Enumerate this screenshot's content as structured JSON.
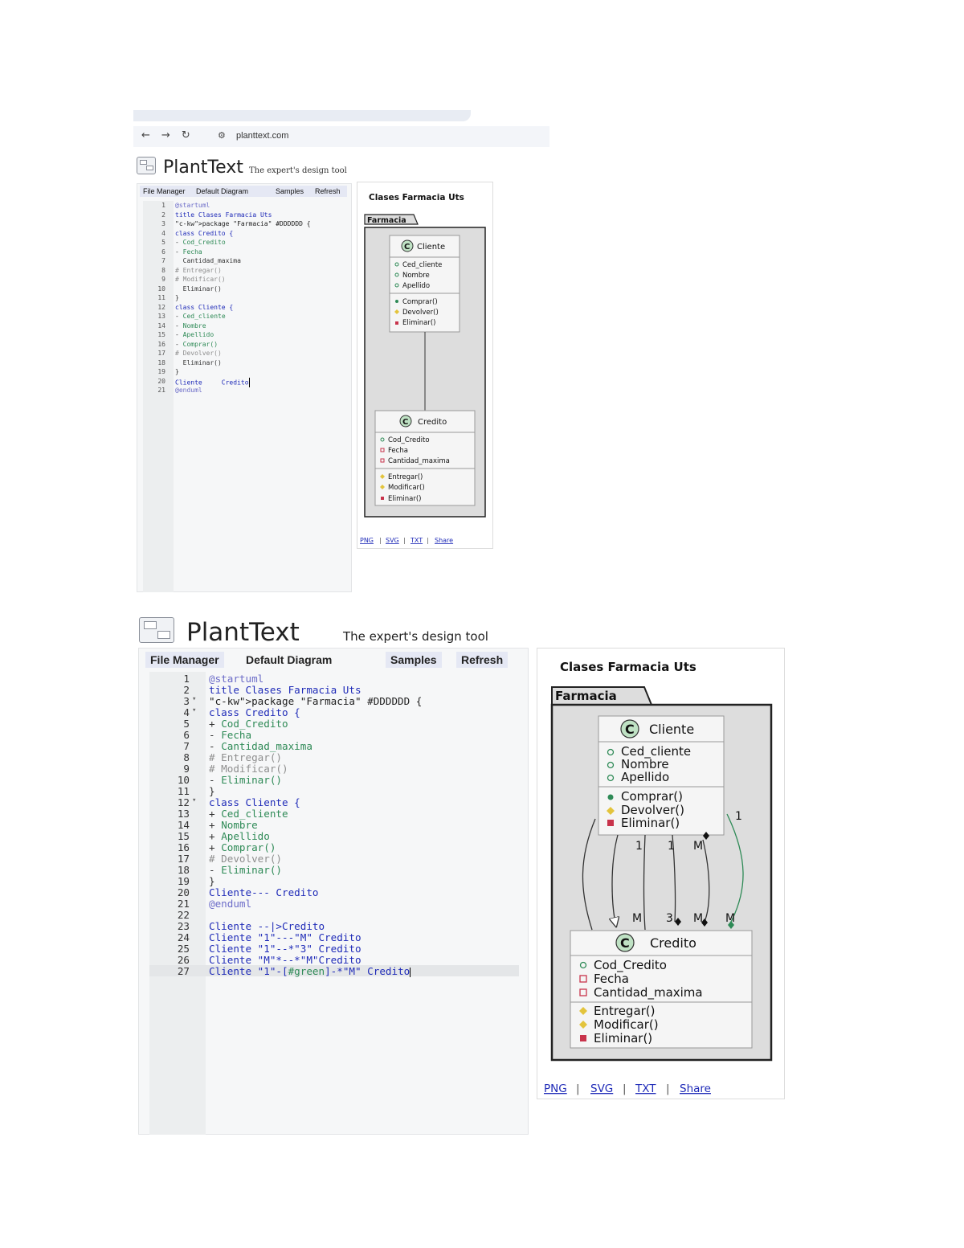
{
  "browser": {
    "url": "planttext.com"
  },
  "app": {
    "name": "PlantText",
    "tagline": "The expert's design tool"
  },
  "toolbar": {
    "file_manager": "File Manager",
    "default_diagram": "Default Diagram",
    "samples": "Samples",
    "refresh": "Refresh"
  },
  "editor_top": {
    "lines": [
      {
        "n": "1",
        "t": "@startuml"
      },
      {
        "n": "2",
        "t": "title Clases Farmacia Uts"
      },
      {
        "n": "3",
        "t": "package \"Farmacia\" #DDDDDD {"
      },
      {
        "n": "4",
        "t": "class Credito {"
      },
      {
        "n": "5",
        "t": "- Cod_Credito"
      },
      {
        "n": "6",
        "t": "- Fecha"
      },
      {
        "n": "7",
        "t": "  Cantidad_maxima"
      },
      {
        "n": "8",
        "t": "# Entregar()"
      },
      {
        "n": "9",
        "t": "# Modificar()"
      },
      {
        "n": "10",
        "t": "  Eliminar()"
      },
      {
        "n": "11",
        "t": "}"
      },
      {
        "n": "12",
        "t": "class Cliente {"
      },
      {
        "n": "13",
        "t": "- Ced_cliente"
      },
      {
        "n": "14",
        "t": "- Nombre"
      },
      {
        "n": "15",
        "t": "- Apellido"
      },
      {
        "n": "16",
        "t": "- Comprar()"
      },
      {
        "n": "17",
        "t": "# Devolver()"
      },
      {
        "n": "18",
        "t": "  Eliminar()"
      },
      {
        "n": "19",
        "t": "}"
      },
      {
        "n": "20",
        "t": "Cliente     Credito"
      },
      {
        "n": "21",
        "t": "@enduml"
      }
    ]
  },
  "editor_bottom": {
    "lines": [
      {
        "n": "1",
        "t": "@startuml"
      },
      {
        "n": "2",
        "t": "title Clases Farmacia Uts"
      },
      {
        "n": "3",
        "t": "package \"Farmacia\" #DDDDDD {"
      },
      {
        "n": "4",
        "t": "class Credito {"
      },
      {
        "n": "5",
        "t": "+ Cod_Credito"
      },
      {
        "n": "6",
        "t": "- Fecha"
      },
      {
        "n": "7",
        "t": "- Cantidad_maxima"
      },
      {
        "n": "8",
        "t": "# Entregar()"
      },
      {
        "n": "9",
        "t": "# Modificar()"
      },
      {
        "n": "10",
        "t": "- Eliminar()"
      },
      {
        "n": "11",
        "t": "}"
      },
      {
        "n": "12",
        "t": "class Cliente {"
      },
      {
        "n": "13",
        "t": "+ Ced_cliente"
      },
      {
        "n": "14",
        "t": "+ Nombre"
      },
      {
        "n": "15",
        "t": "+ Apellido"
      },
      {
        "n": "16",
        "t": "+ Comprar()"
      },
      {
        "n": "17",
        "t": "# Devolver()"
      },
      {
        "n": "18",
        "t": "- Eliminar()"
      },
      {
        "n": "19",
        "t": "}"
      },
      {
        "n": "20",
        "t": "Cliente--- Credito"
      },
      {
        "n": "21",
        "t": "@enduml"
      },
      {
        "n": "22",
        "t": ""
      },
      {
        "n": "23",
        "t": "Cliente --|>Credito"
      },
      {
        "n": "24",
        "t": "Cliente \"1\"---\"M\" Credito"
      },
      {
        "n": "25",
        "t": "Cliente \"1\"--*\"3\" Credito"
      },
      {
        "n": "26",
        "t": "Cliente \"M\"*--*\"M\"Credito"
      },
      {
        "n": "27",
        "t": "Cliente \"1\"-[#green]-*\"M\" Credito"
      }
    ]
  },
  "diagram": {
    "title": "Clases Farmacia Uts",
    "package": "Farmacia",
    "cliente": {
      "name": "Cliente",
      "stereotype": "C",
      "fields": [
        "Ced_cliente",
        "Nombre",
        "Apellido"
      ],
      "methods": [
        "Comprar()",
        "Devolver()",
        "Eliminar()"
      ]
    },
    "credito": {
      "name": "Credito",
      "stereotype": "C",
      "fields": [
        "Cod_Credito",
        "Fecha",
        "Cantidad_maxima"
      ],
      "methods": [
        "Entregar()",
        "Modificar()",
        "Eliminar()"
      ]
    },
    "multiplicity_labels": {
      "top": [
        "1",
        "1",
        "M",
        "1"
      ],
      "bottom": [
        "M",
        "3",
        "M",
        "M"
      ]
    }
  },
  "export_links": {
    "png": "PNG",
    "svg": "SVG",
    "txt": "TXT",
    "share": "Share",
    "separator": "|"
  },
  "colors": {
    "public": "#2e8a56",
    "protected": "#e3c43c",
    "private": "#c8334b",
    "package_fill": "#dddddd",
    "green_link": "#2e8a56",
    "menu_bg": "#e5e8f4",
    "keyword": "#1f2bb8"
  }
}
